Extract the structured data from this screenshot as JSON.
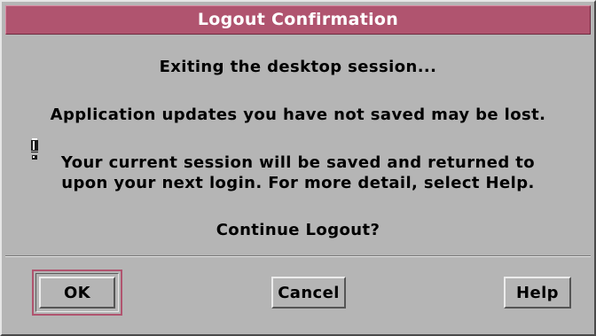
{
  "dialog": {
    "title": "Logout Confirmation",
    "messages": [
      "Exiting the desktop session...",
      "Application updates you have not saved may be lost.",
      "Your current session will be saved and returned to",
      "upon your next login.  For more detail, select Help.",
      "Continue Logout?"
    ],
    "icon": "exclamation-icon",
    "buttons": {
      "ok": "OK",
      "cancel": "Cancel",
      "help": "Help"
    },
    "colors": {
      "titlebar": "#b0546f",
      "background": "#b5b5b5"
    }
  }
}
